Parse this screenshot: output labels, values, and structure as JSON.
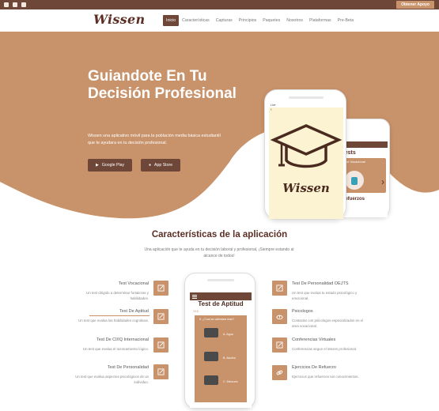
{
  "topbar": {
    "support_label": "Obtener Apoyo",
    "social_icons": [
      "facebook-icon",
      "twitter-icon",
      "instagram-icon"
    ]
  },
  "nav": {
    "logo": "Wissen",
    "items": [
      "Inicio",
      "Características",
      "Capturas",
      "Principios",
      "Paquetes",
      "Nosotros",
      "Plataformas",
      "Pre-Beta"
    ],
    "active": "Inicio"
  },
  "hero": {
    "title": "Guiandote En Tu Decisión Profesional",
    "description": "Wissen una aplicativo móvil para la población media básica estudiantil que te ayudara en tu decisión profesional.",
    "google_play": "Google Play",
    "app_store": "App Store",
    "phone_logo": "Wissen",
    "phone_status": "Live",
    "phone2_title": "Tests",
    "phone2_card": "Test Vocacional",
    "phone2_bottom": "Refuerzos"
  },
  "features": {
    "title": "Características de la aplicación",
    "subtitle": "Una aplicación que te ayuda en tu decisión laboral y profesional, ¡Siempre estando al alcance de todos!",
    "left": [
      {
        "title": "Test Vocacional",
        "desc": "Un test dirigido a determinar fortalezas y habilidades."
      },
      {
        "title": "Test De Aptitud",
        "desc": "Un test que evalua las habilidades cognitivas."
      },
      {
        "title": "Test De CI/IQ Internacional",
        "desc": "Un test que evalua el razonamiento lógico."
      },
      {
        "title": "Test De Personalidad",
        "desc": "Un test que evalua aspectos psicológicos de un individuo."
      }
    ],
    "right": [
      {
        "title": "Test De Personalidad OEJTS",
        "desc": "Un test que evalua tu estado psicológico y emocional."
      },
      {
        "title": "Psicologos",
        "desc": "Contactar con psicologos especializados en el area vocacional."
      },
      {
        "title": "Conferencias Virtuales",
        "desc": "Conferencias segun el interes profesional."
      },
      {
        "title": "Ejercicios De Refuerzo",
        "desc": "Ejercicios que refuercen tus conocimientos."
      }
    ],
    "phone": {
      "title": "Test de Aptitud",
      "progress": "1/15",
      "question": "5. ¿Cual se calentara mas?",
      "options": [
        "A. Agua",
        "B. Alcohol",
        "C. Mercurio"
      ]
    }
  },
  "colors": {
    "brand_dark": "#6e4738",
    "brand_light": "#c8926a",
    "text": "#5b2f25"
  }
}
